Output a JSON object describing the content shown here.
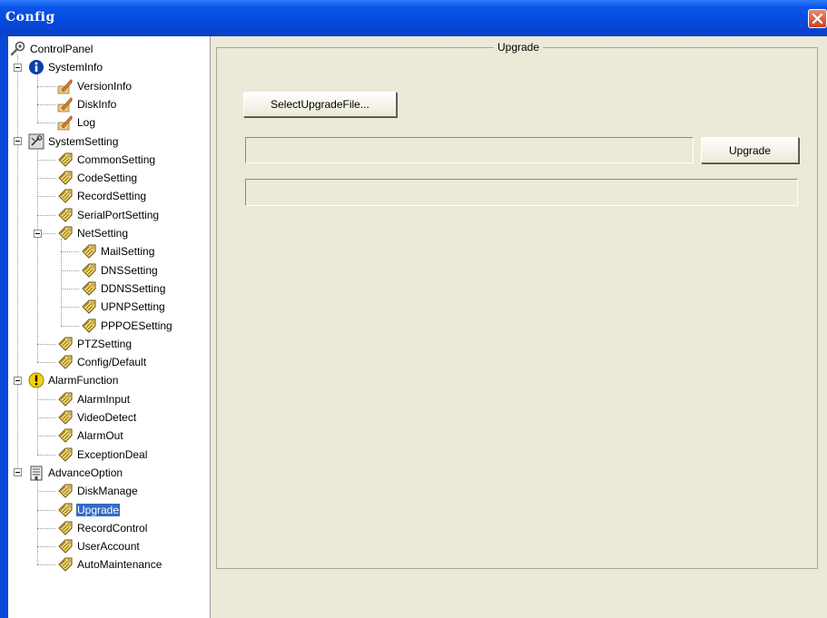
{
  "window": {
    "title": "Config"
  },
  "tree": [
    {
      "label": "ControlPanel",
      "icon": "wrench-icon"
    },
    {
      "label": "SystemInfo",
      "icon": "info-icon"
    },
    {
      "label": "VersionInfo",
      "icon": "pencil-icon"
    },
    {
      "label": "DiskInfo",
      "icon": "pencil-icon"
    },
    {
      "label": "Log",
      "icon": "pencil-icon"
    },
    {
      "label": "SystemSetting",
      "icon": "settings-icon"
    },
    {
      "label": "CommonSetting",
      "icon": "tag-icon"
    },
    {
      "label": "CodeSetting",
      "icon": "tag-icon"
    },
    {
      "label": "RecordSetting",
      "icon": "tag-icon"
    },
    {
      "label": "SerialPortSetting",
      "icon": "tag-icon"
    },
    {
      "label": "NetSetting",
      "icon": "tag-icon"
    },
    {
      "label": "MailSetting",
      "icon": "tag-icon"
    },
    {
      "label": "DNSSetting",
      "icon": "tag-icon"
    },
    {
      "label": "DDNSSetting",
      "icon": "tag-icon"
    },
    {
      "label": "UPNPSetting",
      "icon": "tag-icon"
    },
    {
      "label": "PPPOESetting",
      "icon": "tag-icon"
    },
    {
      "label": "PTZSetting",
      "icon": "tag-icon"
    },
    {
      "label": "Config/Default",
      "icon": "tag-icon"
    },
    {
      "label": "AlarmFunction",
      "icon": "warning-icon"
    },
    {
      "label": "AlarmInput",
      "icon": "tag-icon"
    },
    {
      "label": "VideoDetect",
      "icon": "tag-icon"
    },
    {
      "label": "AlarmOut",
      "icon": "tag-icon"
    },
    {
      "label": "ExceptionDeal",
      "icon": "tag-icon"
    },
    {
      "label": "AdvanceOption",
      "icon": "building-icon"
    },
    {
      "label": "DiskManage",
      "icon": "tag-icon"
    },
    {
      "label": "Upgrade",
      "icon": "tag-icon",
      "selected": true
    },
    {
      "label": "RecordControl",
      "icon": "tag-icon"
    },
    {
      "label": "UserAccount",
      "icon": "tag-icon"
    },
    {
      "label": "AutoMaintenance",
      "icon": "tag-icon"
    }
  ],
  "upgrade": {
    "group_title": "Upgrade",
    "select_file_label": "SelectUpgradeFile...",
    "file_path_value": "",
    "upgrade_button_label": "Upgrade",
    "progress_percent": 0
  },
  "colors": {
    "titlebar": "#0548dc",
    "selection": "#316ac5",
    "dialog_bg": "#ece9d8"
  }
}
